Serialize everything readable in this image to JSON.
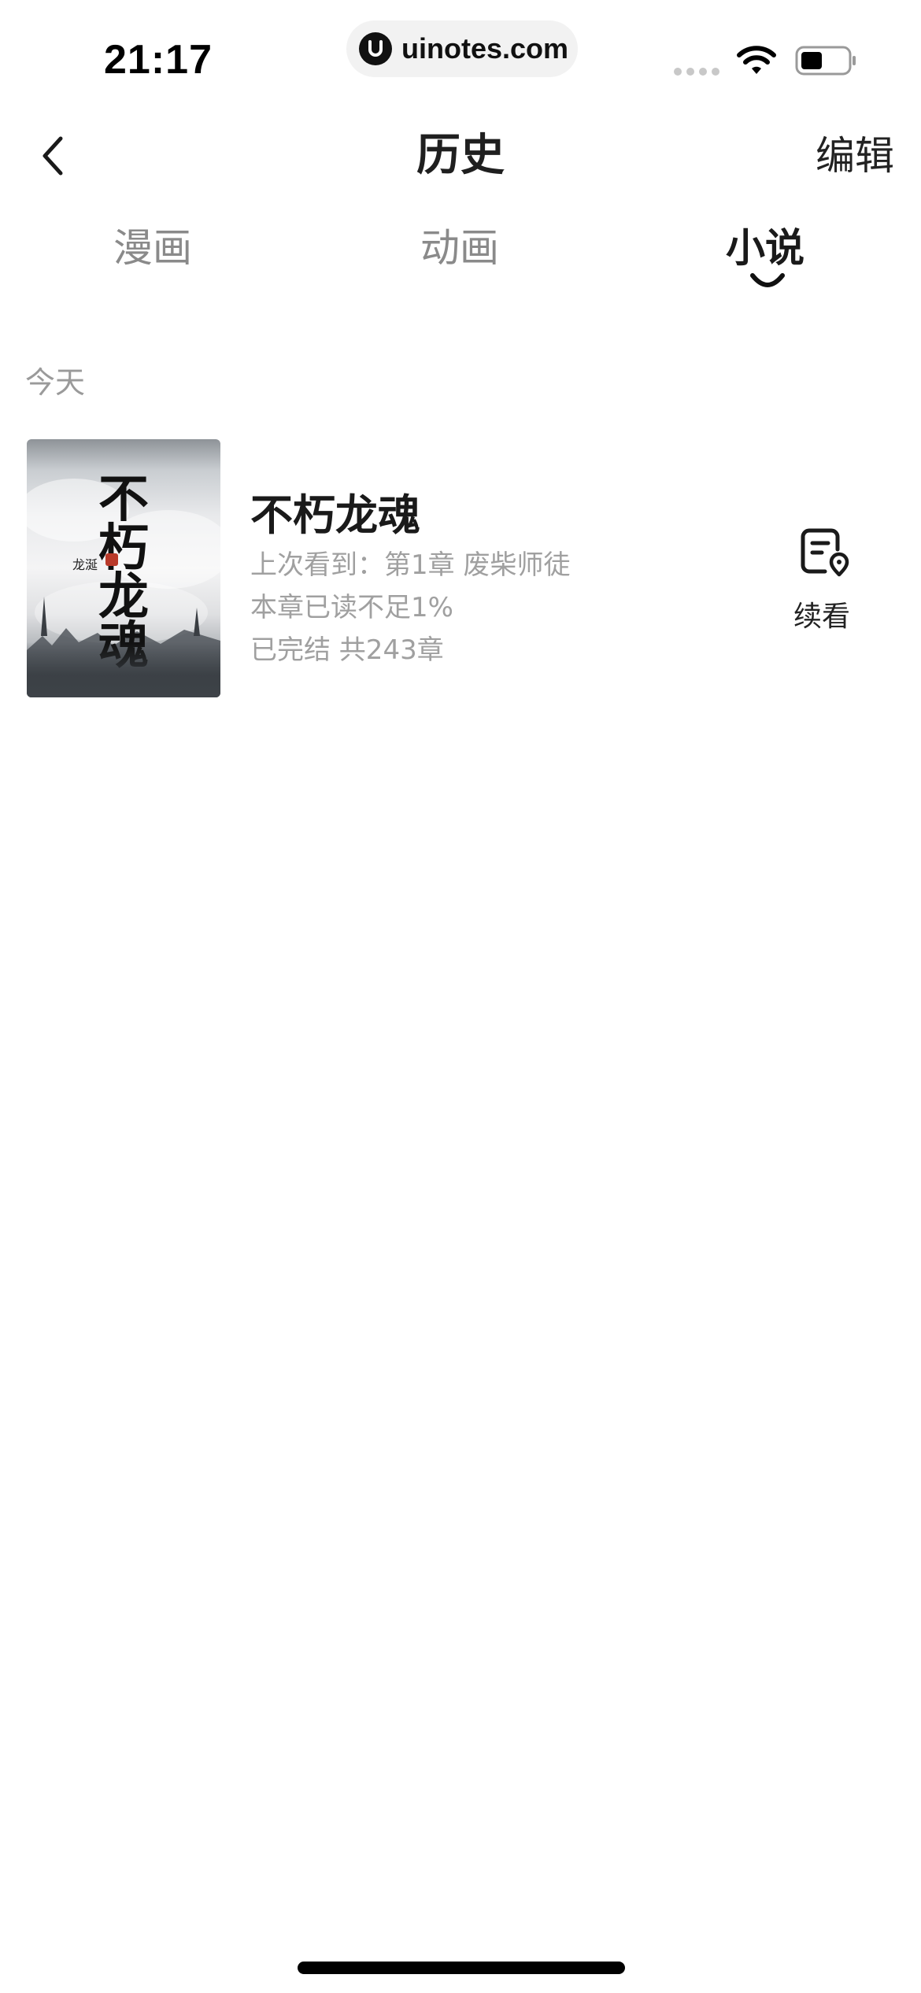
{
  "status_bar": {
    "time": "21:17",
    "url": "uinotes.com"
  },
  "header": {
    "title": "历史",
    "edit_label": "编辑"
  },
  "tabs": [
    {
      "label": "漫画",
      "active": false
    },
    {
      "label": "动画",
      "active": false
    },
    {
      "label": "小说",
      "active": true
    }
  ],
  "section": {
    "label": "今天"
  },
  "history_items": [
    {
      "title": "不朽龙魂",
      "cover_title": "不朽龙魂",
      "cover_author": "龙涎",
      "last_read": "上次看到：第1章 废柴师徒",
      "progress": "本章已读不足1%",
      "status": "已完结 共243章",
      "continue_label": "续看"
    }
  ],
  "colors": {
    "text_primary": "#1a1a1a",
    "text_secondary": "#a0a0a0",
    "tab_inactive": "#8a8a8a",
    "background": "#ffffff"
  }
}
